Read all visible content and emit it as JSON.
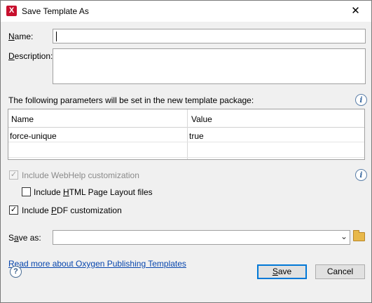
{
  "window": {
    "title": "Save Template As",
    "close_glyph": "✕"
  },
  "fields": {
    "name_label": "Name:",
    "name_value": "",
    "description_label": "Description:",
    "description_value": ""
  },
  "params": {
    "heading": "The following parameters will be set in the new template package:",
    "columns": [
      "Name",
      "Value"
    ],
    "rows": [
      {
        "name": "force-unique",
        "value": "true"
      }
    ]
  },
  "options": {
    "webhelp": {
      "label": "Include WebHelp customization",
      "checked": true,
      "disabled": true
    },
    "html_layout": {
      "label": "Include HTML Page Layout files",
      "checked": false
    },
    "pdf": {
      "label": "Include PDF customization",
      "checked": true
    }
  },
  "save_as": {
    "label": "Save as:",
    "value": ""
  },
  "link": {
    "text": "Read more about Oxygen Publishing Templates"
  },
  "buttons": {
    "save": "Save",
    "cancel": "Cancel"
  },
  "icons": {
    "app": "oxygen-app-icon",
    "info": "info-icon",
    "help": "help-icon",
    "folder": "folder-icon",
    "dropdown": "chevron-down-icon"
  },
  "colors": {
    "link": "#0645ad",
    "default_button_border": "#0078d7"
  }
}
